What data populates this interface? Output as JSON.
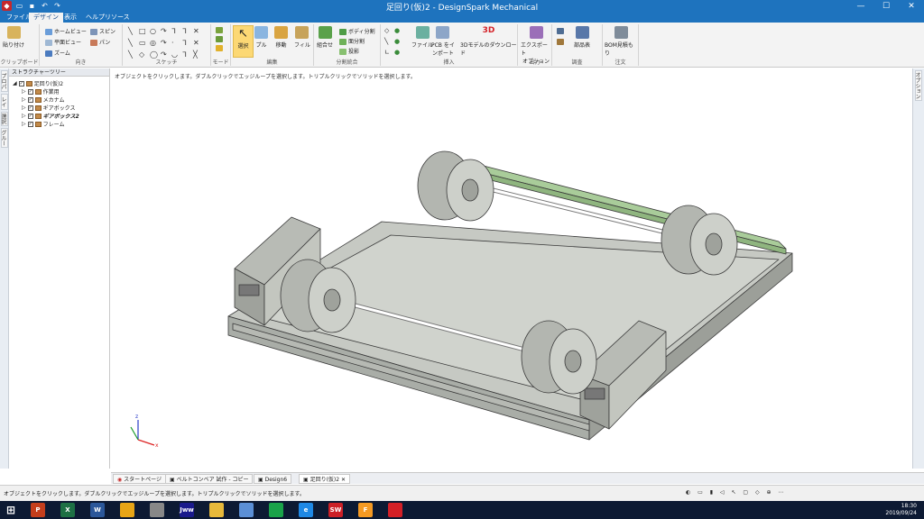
{
  "window": {
    "title": "足回り(仮)2 - DesignSpark Mechanical"
  },
  "tabs": [
    "ファイル(F)",
    "デザイン",
    "表示",
    "ヘルプリソース"
  ],
  "ribbon": {
    "clipboard": {
      "paste": "貼り付け",
      "label": "クリップボード"
    },
    "orient": {
      "home": "ホームビュー",
      "plan": "平面ビュー",
      "zoom": "ズーム",
      "spin": "スピン",
      "pan": "パン",
      "label": "向き"
    },
    "sketch": {
      "label": "スケッチ"
    },
    "mode": {
      "label": "モード"
    },
    "edit": {
      "select": "選択",
      "pull": "プル",
      "move": "移動",
      "fill": "フィル",
      "label": "編集"
    },
    "intersect": {
      "combine": "組合せ",
      "split_body": "ボディ分割",
      "split_face": "面分割",
      "project": "投影",
      "label": "分割統合"
    },
    "insert": {
      "file": "ファイル",
      "pcb1": "PCB をイ",
      "pcb2": "ンポート",
      "model3d": "3Dモデルのダウンロード",
      "badge": "3D",
      "label": "挿入"
    },
    "output": {
      "export1": "エクスポート",
      "export2": "オプション",
      "label": "出力"
    },
    "inspect": {
      "parts": "部品表",
      "label": "調査"
    },
    "order": {
      "bom": "BOM見積もり",
      "label": "注文"
    }
  },
  "structure": {
    "header": "ストラクチャーツリー",
    "items": [
      {
        "label": "足回り(仮)2",
        "depth": 0
      },
      {
        "label": "作業用",
        "depth": 1
      },
      {
        "label": "メカナム",
        "depth": 1
      },
      {
        "label": "ギアボックス",
        "depth": 1
      },
      {
        "label": "ギアボックス2",
        "depth": 1
      },
      {
        "label": "フレーム",
        "depth": 1
      }
    ]
  },
  "side_tabs": [
    "プロパティ",
    "レイヤ",
    "選択",
    "グループ"
  ],
  "right_tab": "オプション",
  "viewport": {
    "hint": "オブジェクトをクリックします。ダブルクリックでエッジループを選択します。トリプルクリックでソリッドを選択します。"
  },
  "doc_tabs": [
    {
      "label": "スタートページ",
      "active": false
    },
    {
      "label": "ベルトコンベア 試作 - コピー",
      "active": false
    },
    {
      "label": "Design6",
      "active": false
    },
    {
      "label": "足回り(仮)2",
      "active": true
    }
  ],
  "status": {
    "message": "オブジェクトをクリックします。ダブルクリックでエッジループを選択します。トリプルクリックでソリッドを選択します。"
  },
  "taskbar": {
    "apps": [
      {
        "name": "powerpoint",
        "glyph": "P",
        "color": "#c43e1c"
      },
      {
        "name": "excel",
        "glyph": "X",
        "color": "#1d7044"
      },
      {
        "name": "word",
        "glyph": "W",
        "color": "#2b579a"
      },
      {
        "name": "chrome",
        "glyph": "",
        "color": "#e8a516"
      },
      {
        "name": "tool",
        "glyph": "",
        "color": "#888888"
      },
      {
        "name": "jww",
        "glyph": "Jww",
        "color": "#1a1a8c"
      },
      {
        "name": "explorer",
        "glyph": "",
        "color": "#e7b93b"
      },
      {
        "name": "notes",
        "glyph": "",
        "color": "#5b8fd6"
      },
      {
        "name": "store",
        "glyph": "",
        "color": "#1aa34a"
      },
      {
        "name": "edge",
        "glyph": "e",
        "color": "#1e88e5"
      },
      {
        "name": "solidworks",
        "glyph": "SW",
        "color": "#cc2027"
      },
      {
        "name": "fusion",
        "glyph": "F",
        "color": "#f59a23"
      },
      {
        "name": "designspark",
        "glyph": "",
        "color": "#d42027"
      }
    ],
    "time": "18:30",
    "date": "2019/09/24"
  }
}
